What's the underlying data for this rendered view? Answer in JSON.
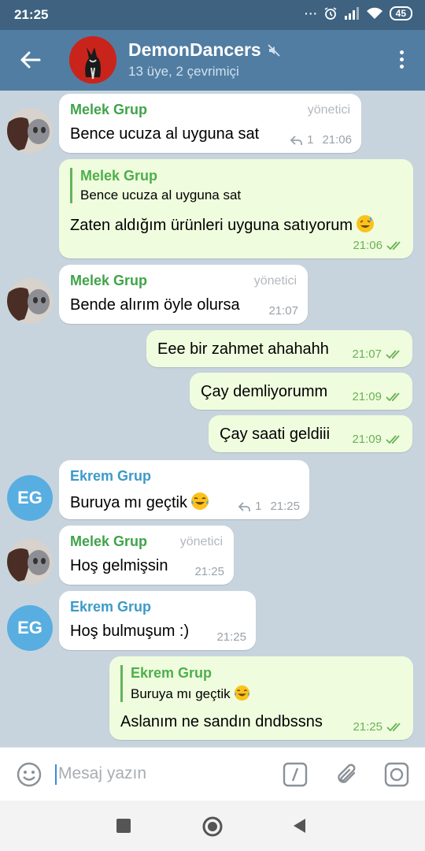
{
  "status_bar": {
    "time": "21:25",
    "battery": "45"
  },
  "header": {
    "title": "DemonDancers",
    "subtitle": "13 üye, 2 çevrimiçi"
  },
  "colors": {
    "header": "#517da2",
    "statusbar": "#3e6280",
    "accent_green": "#4fae4e",
    "sender_green": "#3fa44a",
    "sender_blue": "#3d9ac7",
    "bubble_out": "#effdde"
  },
  "messages": [
    {
      "sender": "Melek Grup",
      "badge": "yönetici",
      "text": "Bence ucuza al uyguna sat",
      "replies": "1",
      "time": "21:06"
    },
    {
      "quote_sender": "Melek Grup",
      "quote_text": "Bence ucuza al uyguna sat",
      "text": "Zaten aldığım ürünleri uyguna satıyorum",
      "emoji": "sweat-smile-emoji",
      "time": "21:06"
    },
    {
      "sender": "Melek Grup",
      "badge": "yönetici",
      "text": "Bende alırım öyle olursa",
      "time": "21:07"
    },
    {
      "text": "Eee bir zahmet ahahahh",
      "time": "21:07"
    },
    {
      "text": "Çay demliyorumm",
      "time": "21:09"
    },
    {
      "text": "Çay saati geldiii",
      "time": "21:09"
    },
    {
      "sender": "Ekrem Grup",
      "avatar_initials": "EG",
      "text": "Buruya mı geçtik",
      "emoji": "tears-of-joy-emoji",
      "replies": "1",
      "time": "21:25"
    },
    {
      "sender": "Melek Grup",
      "badge": "yönetici",
      "text": "Hoş gelmişsin",
      "time": "21:25"
    },
    {
      "sender": "Ekrem Grup",
      "avatar_initials": "EG",
      "text": "Hoş bulmuşum :)",
      "time": "21:25"
    },
    {
      "quote_sender": "Ekrem Grup",
      "quote_text": "Buruya mı geçtik",
      "quote_emoji": "tears-of-joy-emoji",
      "text": "Aslanım ne sandın dndbssns",
      "time": "21:25"
    }
  ],
  "input": {
    "placeholder": "Mesaj yazın"
  }
}
